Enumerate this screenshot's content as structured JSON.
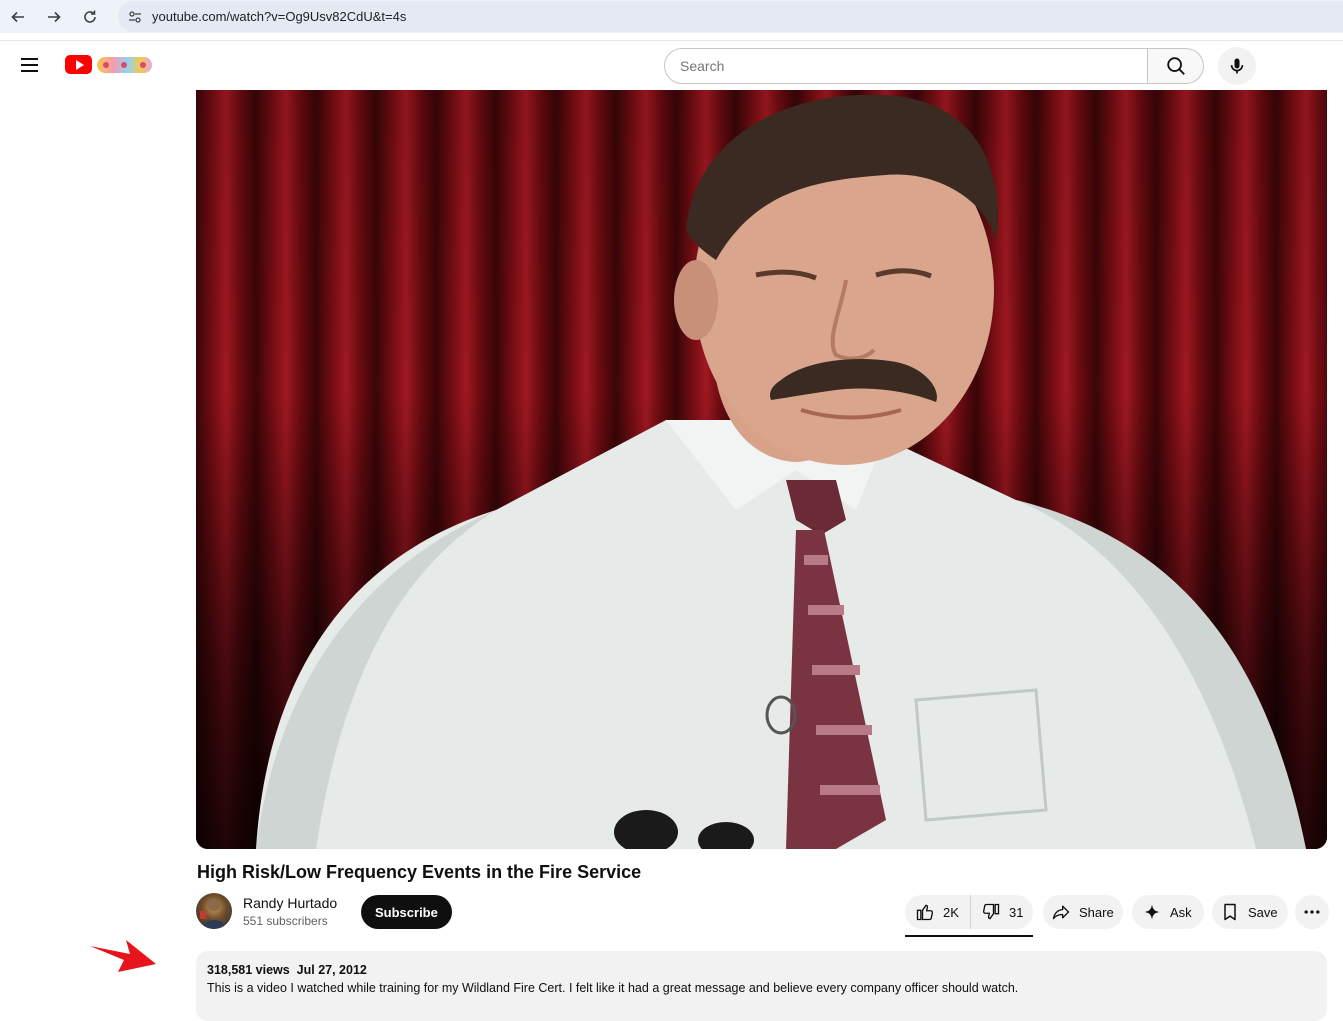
{
  "browser": {
    "url": "youtube.com/watch?v=Og9Usv82CdU&t=4s"
  },
  "header": {
    "search_placeholder": "Search"
  },
  "video": {
    "title": "High Risk/Low Frequency Events in the Fire Service"
  },
  "channel": {
    "name": "Randy Hurtado",
    "subscribers": "551 subscribers",
    "subscribe_label": "Subscribe"
  },
  "actions": {
    "likes": "2K",
    "dislikes": "31",
    "share_label": "Share",
    "ask_label": "Ask",
    "save_label": "Save"
  },
  "description": {
    "views": "318,581 views",
    "date": "Jul 27, 2012",
    "text": "This is a video I watched while training for my Wildland Fire Cert.  I felt like it had a great message and believe every company officer should watch."
  },
  "colors": {
    "brand_red": "#ff0000",
    "annotation_arrow": "#e8141b"
  },
  "icons": [
    "back-icon",
    "forward-icon",
    "reload-icon",
    "site-info-icon",
    "menu-icon",
    "youtube-logo-icon",
    "search-icon",
    "mic-icon",
    "like-icon",
    "dislike-icon",
    "share-icon",
    "ask-sparkle-icon",
    "save-bookmark-icon",
    "more-icon"
  ]
}
